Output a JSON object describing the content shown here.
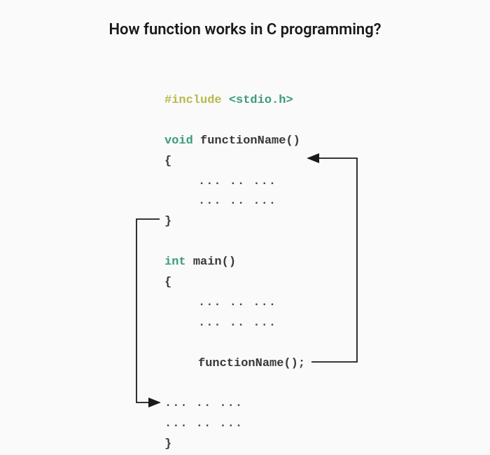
{
  "title": "How function works in C programming?",
  "code": {
    "include_directive": "#include",
    "include_header": "<stdio.h>",
    "void_kw": "void",
    "func_name_decl": "functionName()",
    "brace_open": "{",
    "brace_close": "}",
    "dots": "... .. ...",
    "int_kw": "int",
    "main_decl": "main()",
    "func_call": "functionName();"
  },
  "diagram": {
    "arrow_call": "from functionName(); call in main to top of functionName body",
    "arrow_return": "from closing brace of functionName to line after functionName(); in main"
  },
  "colors": {
    "background": "#fafafa",
    "text": "#1a1a1a",
    "code_text": "#383838",
    "keyword_olive": "#b8b84a",
    "keyword_teal": "#3b9b7a",
    "arrow": "#1a1a1a"
  }
}
